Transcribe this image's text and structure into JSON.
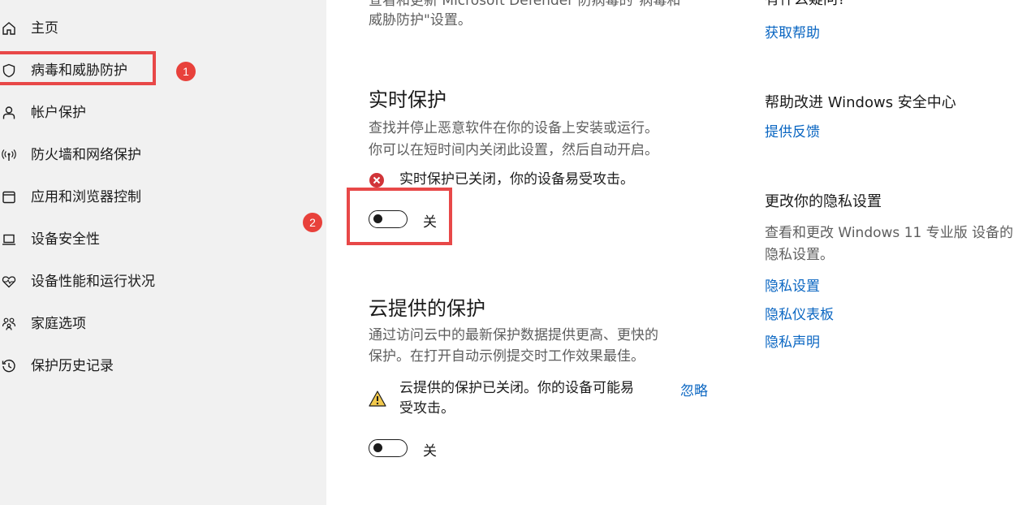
{
  "sidebar": {
    "items": [
      {
        "label": "主页",
        "icon": "home-icon"
      },
      {
        "label": "病毒和威胁防护",
        "icon": "shield-icon"
      },
      {
        "label": "帐户保护",
        "icon": "person-icon"
      },
      {
        "label": "防火墙和网络保护",
        "icon": "antenna-icon"
      },
      {
        "label": "应用和浏览器控制",
        "icon": "app-window-icon"
      },
      {
        "label": "设备安全性",
        "icon": "laptop-icon"
      },
      {
        "label": "设备性能和运行状况",
        "icon": "heart-icon"
      },
      {
        "label": "家庭选项",
        "icon": "family-icon"
      },
      {
        "label": "保护历史记录",
        "icon": "history-icon"
      }
    ],
    "badge1": "1",
    "badge2": "2"
  },
  "main": {
    "top_desc_line1": "查看和更新 Microsoft Defender 防病毒的\"病毒和",
    "top_desc_line2": "威胁防护\"设置。",
    "realtime": {
      "title": "实时保护",
      "desc_line1": "查找并停止恶意软件在你的设备上安装或运行。",
      "desc_line2": "你可以在短时间内关闭此设置，然后自动开启。",
      "status": "实时保护已关闭，你的设备易受攻击。",
      "toggle_label": "关"
    },
    "cloud": {
      "title": "云提供的保护",
      "desc_line1": "通过访问云中的最新保护数据提供更高、更快的",
      "desc_line2": "保护。在打开自动示例提交时工作效果最佳。",
      "status_line1": "云提供的保护已关闭。你的设备可能易",
      "status_line2": "受攻击。",
      "dismiss": "忽略",
      "toggle_label": "关"
    }
  },
  "right": {
    "question_title": "有什么疑问?",
    "get_help": "获取帮助",
    "improve_title": "帮助改进 Windows 安全中心",
    "feedback": "提供反馈",
    "privacy_title": "更改你的隐私设置",
    "privacy_desc": "查看和更改 Windows 11 专业版 设备的隐私设置。",
    "privacy_links": [
      "隐私设置",
      "隐私仪表板",
      "隐私声明"
    ]
  },
  "colors": {
    "accent": "#0a66c2",
    "highlight": "#e84848",
    "error": "#d13438",
    "warning": "#f2c94c"
  }
}
